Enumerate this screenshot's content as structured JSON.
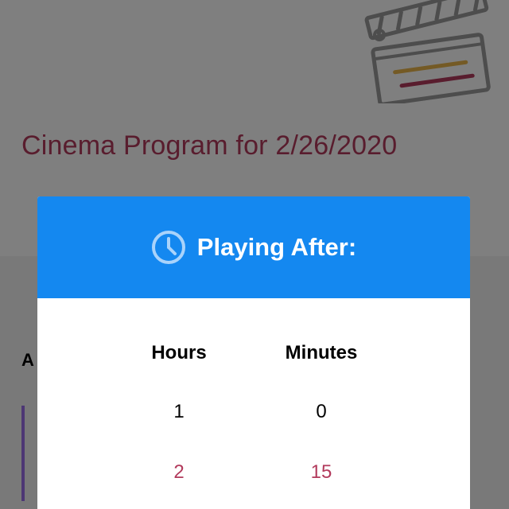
{
  "page": {
    "title": "Cinema Program for 2/26/2020",
    "section_letter": "A",
    "clapper_icon": "clapperboard-icon"
  },
  "modal": {
    "title": "Playing After:",
    "header_icon": "clock-icon",
    "columns": {
      "hours": {
        "label": "Hours",
        "options": [
          "1",
          "2"
        ]
      },
      "minutes": {
        "label": "Minutes",
        "options": [
          "0",
          "15"
        ]
      }
    }
  },
  "colors": {
    "accent_blue": "#1488f0",
    "title_magenta": "#b23a5c",
    "bar_purple": "#9b6fe8"
  }
}
